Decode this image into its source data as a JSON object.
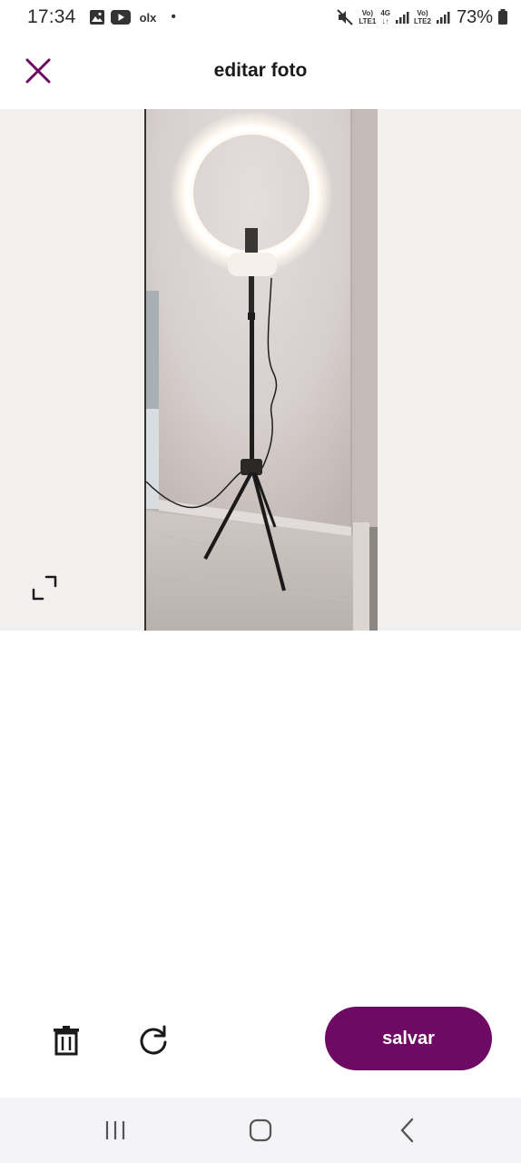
{
  "status_bar": {
    "time": "17:34",
    "left_icons": [
      "gallery-icon",
      "youtube-icon",
      "olx-icon"
    ],
    "olx_label": "olx",
    "net1_top": "Vo)",
    "net1_bottom": "LTE1",
    "net_4g": "4G",
    "net2_top": "Vo)",
    "net2_bottom": "LTE2",
    "battery": "73%"
  },
  "header": {
    "title": "editar foto",
    "close_icon": "close-icon"
  },
  "photo": {
    "description_icon": "crop-icon"
  },
  "actions": {
    "save_label": "salvar",
    "delete_icon": "trash-icon",
    "rotate_icon": "rotate-icon"
  },
  "colors": {
    "accent": "#6e0a63",
    "photo_bg": "#f2f0ef",
    "nav_bg": "#f4f4f6"
  }
}
